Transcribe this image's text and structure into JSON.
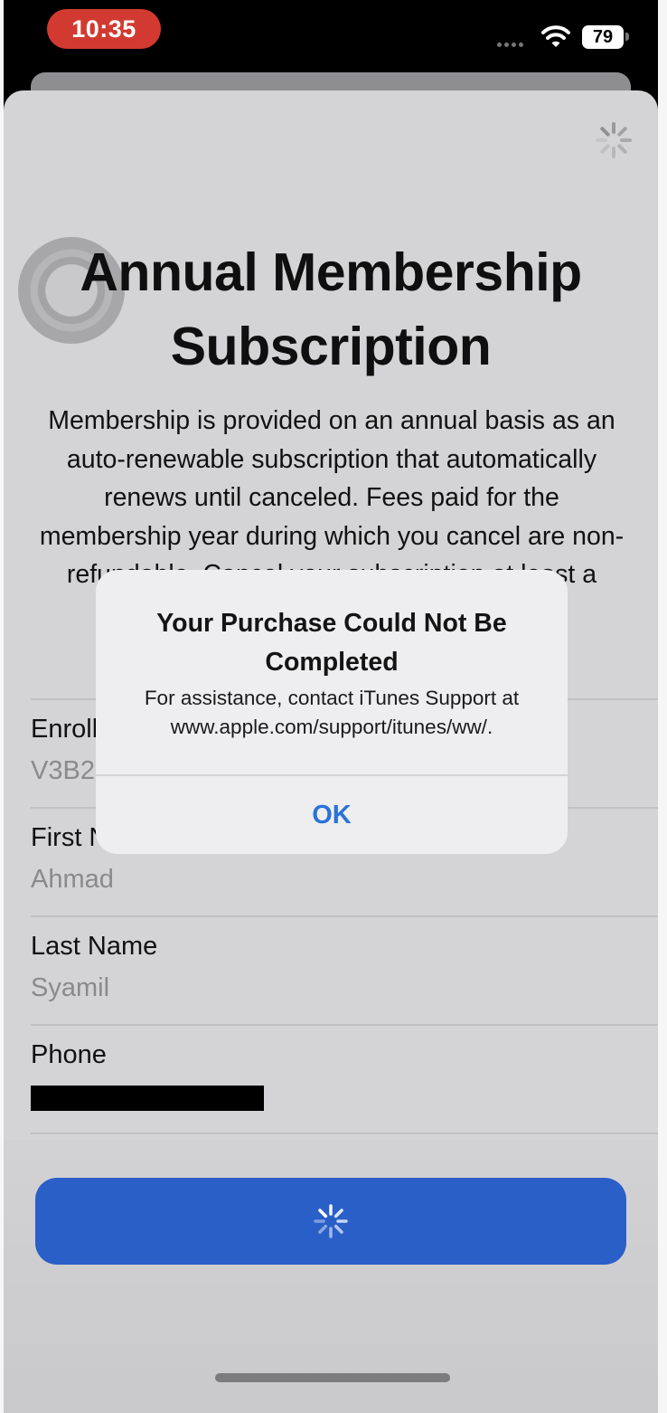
{
  "status_bar": {
    "time": "10:35",
    "battery": "79"
  },
  "page": {
    "title": "Annual Membership Subscription",
    "description": "Membership is provided on an annual basis as an auto-renewable subscription that automatically renews until canceled. Fees paid for the membership year during which you cancel are non-refundable. Cancel your subscription at least a"
  },
  "fields": [
    {
      "label": "Enrollment",
      "value": "V3B2"
    },
    {
      "label": "First Name",
      "value": "Ahmad"
    },
    {
      "label": "Last Name",
      "value": "Syamil"
    },
    {
      "label": "Phone",
      "value": ""
    }
  ],
  "alert": {
    "title": "Your Purchase Could Not Be Completed",
    "message": "For assistance, contact iTunes Support at www.apple.com/support/itunes/ww/.",
    "ok_label": "OK"
  },
  "colors": {
    "accent": "#2a5fc7",
    "alert_button": "#2a73d9",
    "time_pill": "#d23a31"
  },
  "icons": {
    "top_spinner": "activity-spinner-icon",
    "button_spinner": "activity-spinner-icon",
    "wifi": "wifi-icon"
  }
}
